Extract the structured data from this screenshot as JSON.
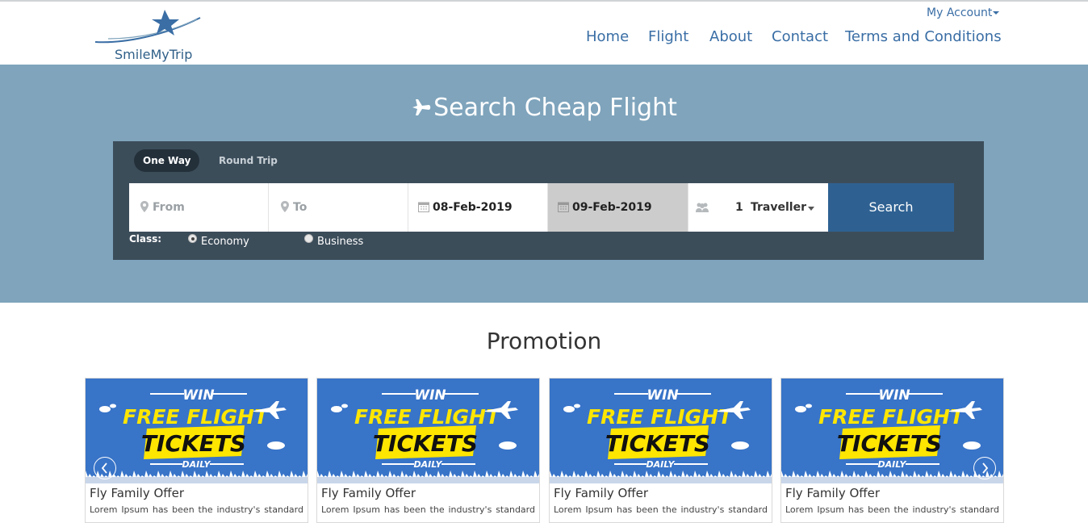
{
  "brand": {
    "name": "SmileMyTrip"
  },
  "header": {
    "account_label": "My Account",
    "nav": [
      "Home",
      "Flight",
      "About",
      "Contact",
      "Terms and Conditions"
    ]
  },
  "hero": {
    "title": "Search Cheap Flight",
    "background": "#7fa4bc",
    "panel_background": "#3c4d5a",
    "trip_types": [
      "One Way",
      "Round Trip"
    ],
    "selected_trip_type": "One Way",
    "from_placeholder": "From",
    "to_placeholder": "To",
    "depart_date": "08-Feb-2019",
    "return_date": "09-Feb-2019",
    "travellers_count": "1",
    "travellers_label": "Traveller",
    "search_label": "Search",
    "search_color": "#2e6192",
    "class_label": "Class:",
    "classes": [
      "Economy",
      "Business"
    ],
    "selected_class": "Economy"
  },
  "promotion": {
    "title": "Promotion",
    "cards": [
      {
        "banner_win": "WIN",
        "banner_line1": "FREE FLIGHT",
        "banner_line2": "TICKETS",
        "banner_daily": "DAILY",
        "title": "Fly Family Offer",
        "desc": "Lorem Ipsum has been the industry's standard"
      },
      {
        "banner_win": "WIN",
        "banner_line1": "FREE FLIGHT",
        "banner_line2": "TICKETS",
        "banner_daily": "DAILY",
        "title": "Fly Family Offer",
        "desc": "Lorem Ipsum has been the industry's standard"
      },
      {
        "banner_win": "WIN",
        "banner_line1": "FREE FLIGHT",
        "banner_line2": "TICKETS",
        "banner_daily": "DAILY",
        "title": "Fly Family Offer",
        "desc": "Lorem Ipsum has been the industry's standard"
      },
      {
        "banner_win": "WIN",
        "banner_line1": "FREE FLIGHT",
        "banner_line2": "TICKETS",
        "banner_daily": "DAILY",
        "title": "Fly Family Offer",
        "desc": "Lorem Ipsum has been the industry's standard"
      }
    ],
    "banner_color": "#3874c8",
    "banner_highlight": "#ffe600"
  }
}
